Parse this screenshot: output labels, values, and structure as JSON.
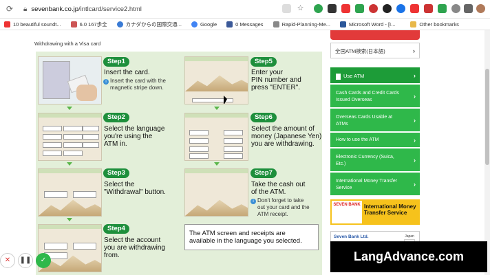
{
  "browser": {
    "url_host": "sevenbank.co.jp",
    "url_path": "/intlcard/service2.html",
    "bookmarks": [
      {
        "label": "10 beautiful soundt...",
        "color": "#e33"
      },
      {
        "label": "6.0 167歩全",
        "color": "#c55"
      },
      {
        "label": "カナダからの国際交通...",
        "color": "#3a7bd5"
      },
      {
        "label": "Google",
        "color": "#4285f4"
      },
      {
        "label": "0 Messages",
        "color": "#3b5998"
      },
      {
        "label": "Rapid-Planning-Me...",
        "color": "#888"
      },
      {
        "label": "Microsoft Word - [I...",
        "color": "#2b579a"
      },
      {
        "label": "Other bookmarks",
        "color": "#e8b84a"
      }
    ]
  },
  "page": {
    "heading": "Withdrawing with a Visa card"
  },
  "steps": [
    {
      "pill": "Step1",
      "title_l1": "Insert the card.",
      "sub_l1": "Insert the card with the",
      "sub_l2": "magnetic stripe down."
    },
    {
      "pill": "Step2",
      "title_l1": "Select the language",
      "title_l2": "you're using the",
      "title_l3": "ATM in."
    },
    {
      "pill": "Step3",
      "title_l1": "Select the",
      "title_l2": "\"Withdrawal\" button."
    },
    {
      "pill": "Step4",
      "title_l1": "Select the account",
      "title_l2": "you are withdrawing",
      "title_l3": "from."
    },
    {
      "pill": "Step5",
      "title_l1": "Enter your",
      "title_l2": "PIN number and",
      "title_l3": "press \"ENTER\"."
    },
    {
      "pill": "Step6",
      "title_l1": "Select the amount of",
      "title_l2": "money (Japanese Yen)",
      "title_l3": "you are withdrawing."
    },
    {
      "pill": "Step7",
      "title_l1": "Take the cash out",
      "title_l2": "of the ATM.",
      "sub_l1": "Don't forget to take",
      "sub_l2": "out your card and the",
      "sub_l3": "ATM receipt."
    }
  ],
  "note": {
    "l1": "The ATM screen and receipts are",
    "l2": "available in the language you selected."
  },
  "sidebar": {
    "search_label": "全国ATM検索(日本語)",
    "menu": [
      {
        "label": "Use ATM"
      },
      {
        "label": "Cash Cards and Credit Cards Issued Overseas"
      },
      {
        "label": "Overseas Cards Usable at ATMs"
      },
      {
        "label": "How to use the ATM"
      },
      {
        "label": "Electronic Currency (Suica, Etc.)"
      },
      {
        "label": "International Money Transfer Service"
      }
    ],
    "banner_logo": "SEVEN BANK",
    "banner_text": "International Money Transfer Service",
    "footer_title": "Seven Bank Ltd.",
    "footer_flag_label": "Japan"
  },
  "watermark": "LangAdvance.com"
}
